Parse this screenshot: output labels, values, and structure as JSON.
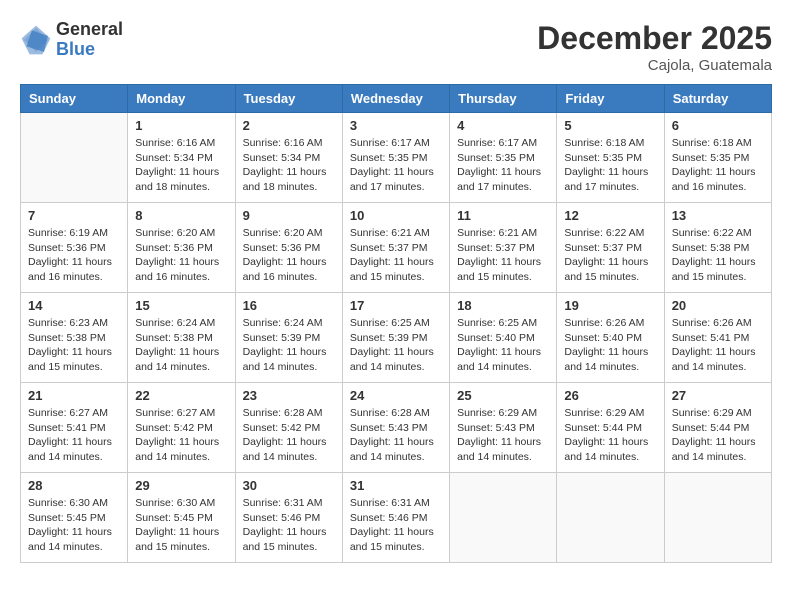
{
  "logo": {
    "general": "General",
    "blue": "Blue"
  },
  "title": "December 2025",
  "location": "Cajola, Guatemala",
  "days_header": [
    "Sunday",
    "Monday",
    "Tuesday",
    "Wednesday",
    "Thursday",
    "Friday",
    "Saturday"
  ],
  "weeks": [
    [
      {
        "day": "",
        "sunrise": "",
        "sunset": "",
        "daylight": ""
      },
      {
        "day": "1",
        "sunrise": "Sunrise: 6:16 AM",
        "sunset": "Sunset: 5:34 PM",
        "daylight": "Daylight: 11 hours and 18 minutes."
      },
      {
        "day": "2",
        "sunrise": "Sunrise: 6:16 AM",
        "sunset": "Sunset: 5:34 PM",
        "daylight": "Daylight: 11 hours and 18 minutes."
      },
      {
        "day": "3",
        "sunrise": "Sunrise: 6:17 AM",
        "sunset": "Sunset: 5:35 PM",
        "daylight": "Daylight: 11 hours and 17 minutes."
      },
      {
        "day": "4",
        "sunrise": "Sunrise: 6:17 AM",
        "sunset": "Sunset: 5:35 PM",
        "daylight": "Daylight: 11 hours and 17 minutes."
      },
      {
        "day": "5",
        "sunrise": "Sunrise: 6:18 AM",
        "sunset": "Sunset: 5:35 PM",
        "daylight": "Daylight: 11 hours and 17 minutes."
      },
      {
        "day": "6",
        "sunrise": "Sunrise: 6:18 AM",
        "sunset": "Sunset: 5:35 PM",
        "daylight": "Daylight: 11 hours and 16 minutes."
      }
    ],
    [
      {
        "day": "7",
        "sunrise": "Sunrise: 6:19 AM",
        "sunset": "Sunset: 5:36 PM",
        "daylight": "Daylight: 11 hours and 16 minutes."
      },
      {
        "day": "8",
        "sunrise": "Sunrise: 6:20 AM",
        "sunset": "Sunset: 5:36 PM",
        "daylight": "Daylight: 11 hours and 16 minutes."
      },
      {
        "day": "9",
        "sunrise": "Sunrise: 6:20 AM",
        "sunset": "Sunset: 5:36 PM",
        "daylight": "Daylight: 11 hours and 16 minutes."
      },
      {
        "day": "10",
        "sunrise": "Sunrise: 6:21 AM",
        "sunset": "Sunset: 5:37 PM",
        "daylight": "Daylight: 11 hours and 15 minutes."
      },
      {
        "day": "11",
        "sunrise": "Sunrise: 6:21 AM",
        "sunset": "Sunset: 5:37 PM",
        "daylight": "Daylight: 11 hours and 15 minutes."
      },
      {
        "day": "12",
        "sunrise": "Sunrise: 6:22 AM",
        "sunset": "Sunset: 5:37 PM",
        "daylight": "Daylight: 11 hours and 15 minutes."
      },
      {
        "day": "13",
        "sunrise": "Sunrise: 6:22 AM",
        "sunset": "Sunset: 5:38 PM",
        "daylight": "Daylight: 11 hours and 15 minutes."
      }
    ],
    [
      {
        "day": "14",
        "sunrise": "Sunrise: 6:23 AM",
        "sunset": "Sunset: 5:38 PM",
        "daylight": "Daylight: 11 hours and 15 minutes."
      },
      {
        "day": "15",
        "sunrise": "Sunrise: 6:24 AM",
        "sunset": "Sunset: 5:38 PM",
        "daylight": "Daylight: 11 hours and 14 minutes."
      },
      {
        "day": "16",
        "sunrise": "Sunrise: 6:24 AM",
        "sunset": "Sunset: 5:39 PM",
        "daylight": "Daylight: 11 hours and 14 minutes."
      },
      {
        "day": "17",
        "sunrise": "Sunrise: 6:25 AM",
        "sunset": "Sunset: 5:39 PM",
        "daylight": "Daylight: 11 hours and 14 minutes."
      },
      {
        "day": "18",
        "sunrise": "Sunrise: 6:25 AM",
        "sunset": "Sunset: 5:40 PM",
        "daylight": "Daylight: 11 hours and 14 minutes."
      },
      {
        "day": "19",
        "sunrise": "Sunrise: 6:26 AM",
        "sunset": "Sunset: 5:40 PM",
        "daylight": "Daylight: 11 hours and 14 minutes."
      },
      {
        "day": "20",
        "sunrise": "Sunrise: 6:26 AM",
        "sunset": "Sunset: 5:41 PM",
        "daylight": "Daylight: 11 hours and 14 minutes."
      }
    ],
    [
      {
        "day": "21",
        "sunrise": "Sunrise: 6:27 AM",
        "sunset": "Sunset: 5:41 PM",
        "daylight": "Daylight: 11 hours and 14 minutes."
      },
      {
        "day": "22",
        "sunrise": "Sunrise: 6:27 AM",
        "sunset": "Sunset: 5:42 PM",
        "daylight": "Daylight: 11 hours and 14 minutes."
      },
      {
        "day": "23",
        "sunrise": "Sunrise: 6:28 AM",
        "sunset": "Sunset: 5:42 PM",
        "daylight": "Daylight: 11 hours and 14 minutes."
      },
      {
        "day": "24",
        "sunrise": "Sunrise: 6:28 AM",
        "sunset": "Sunset: 5:43 PM",
        "daylight": "Daylight: 11 hours and 14 minutes."
      },
      {
        "day": "25",
        "sunrise": "Sunrise: 6:29 AM",
        "sunset": "Sunset: 5:43 PM",
        "daylight": "Daylight: 11 hours and 14 minutes."
      },
      {
        "day": "26",
        "sunrise": "Sunrise: 6:29 AM",
        "sunset": "Sunset: 5:44 PM",
        "daylight": "Daylight: 11 hours and 14 minutes."
      },
      {
        "day": "27",
        "sunrise": "Sunrise: 6:29 AM",
        "sunset": "Sunset: 5:44 PM",
        "daylight": "Daylight: 11 hours and 14 minutes."
      }
    ],
    [
      {
        "day": "28",
        "sunrise": "Sunrise: 6:30 AM",
        "sunset": "Sunset: 5:45 PM",
        "daylight": "Daylight: 11 hours and 14 minutes."
      },
      {
        "day": "29",
        "sunrise": "Sunrise: 6:30 AM",
        "sunset": "Sunset: 5:45 PM",
        "daylight": "Daylight: 11 hours and 15 minutes."
      },
      {
        "day": "30",
        "sunrise": "Sunrise: 6:31 AM",
        "sunset": "Sunset: 5:46 PM",
        "daylight": "Daylight: 11 hours and 15 minutes."
      },
      {
        "day": "31",
        "sunrise": "Sunrise: 6:31 AM",
        "sunset": "Sunset: 5:46 PM",
        "daylight": "Daylight: 11 hours and 15 minutes."
      },
      {
        "day": "",
        "sunrise": "",
        "sunset": "",
        "daylight": ""
      },
      {
        "day": "",
        "sunrise": "",
        "sunset": "",
        "daylight": ""
      },
      {
        "day": "",
        "sunrise": "",
        "sunset": "",
        "daylight": ""
      }
    ]
  ]
}
